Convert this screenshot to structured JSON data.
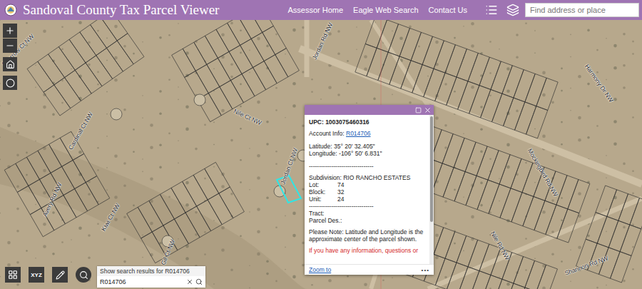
{
  "header": {
    "title": "Sandoval County Tax Parcel Viewer",
    "links": [
      "Assessor Home",
      "Eagle Web Search",
      "Contact Us"
    ],
    "search_placeholder": "Find address or place"
  },
  "map": {
    "street_labels": [
      "Sparrow Ct NW",
      "Cardinal Ct NW",
      "Nile Ct NW",
      "Jordan Rd NW",
      "Jordan Ct NW",
      "Avery Rd NW",
      "Kiwi Ct NW",
      "Gil Ct NW",
      "Mockingbird Rd NW",
      "Harmony Dr NW",
      "Shannon Rd NW",
      "Nile Rd NW"
    ]
  },
  "popup": {
    "upc": "UPC: 1003075460316",
    "account_label": "Account Info:",
    "account_link": "R014706",
    "latitude": "Latitude: 35° 20' 32.405\"",
    "longitude": "Longitude: -106° 50' 6.831\"",
    "divider": "--------------------------------",
    "subdivision": "Subdivision: RIO RANCHO ESTATES",
    "fields": [
      {
        "label": "Lot:",
        "value": "74"
      },
      {
        "label": "Block:",
        "value": "32"
      },
      {
        "label": "Unit:",
        "value": "24"
      }
    ],
    "tract": "Tract:",
    "parcel_des": "Parcel Des.:",
    "note": "Please Note: Latitude and Longitude is the approximate center of the parcel shown.",
    "warning": "If you have any information, questions or",
    "zoom_link": "Zoom to",
    "more": "•••",
    "scroll_level": 0.72
  },
  "toolbar": {
    "coordinates_button": "XYZ"
  },
  "search": {
    "suggestion": "Show search results for R014706",
    "value": "R014706"
  }
}
